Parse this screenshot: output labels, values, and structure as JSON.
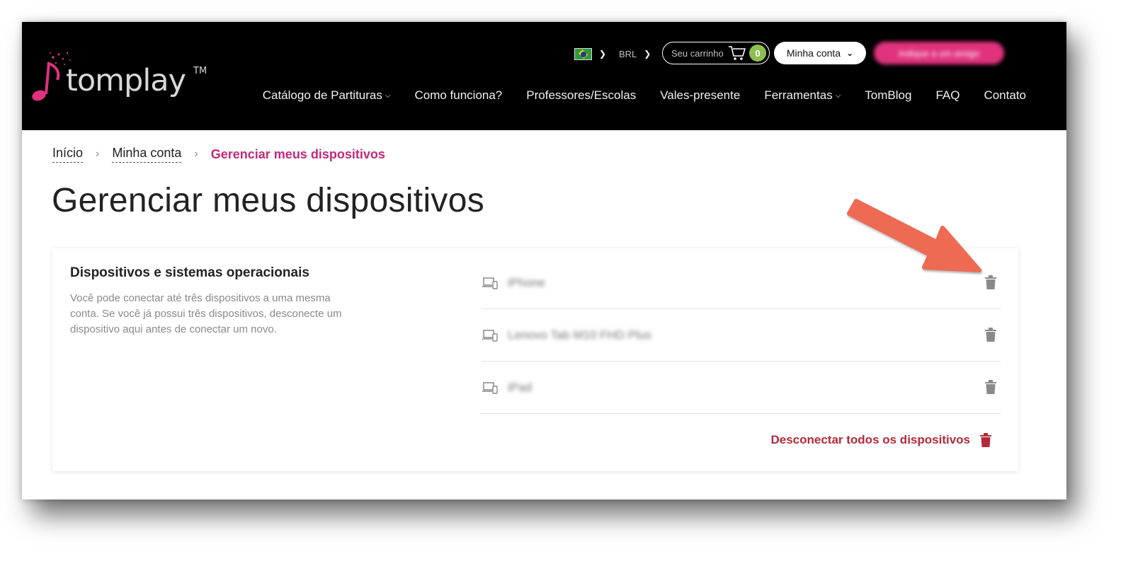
{
  "header": {
    "logo_text": "tomplay",
    "logo_tm": "TM",
    "currency": "BRL",
    "cart_label": "Seu carrinho",
    "cart_count": "0",
    "account_label": "Minha conta",
    "refer_label": "Indique a um amigo",
    "nav": [
      {
        "label": "Catálogo de Partituras"
      },
      {
        "label": "Como funciona?"
      },
      {
        "label": "Professores/Escolas"
      },
      {
        "label": "Vales-presente"
      },
      {
        "label": "Ferramentas"
      },
      {
        "label": "TomBlog"
      },
      {
        "label": "FAQ"
      },
      {
        "label": "Contato"
      }
    ]
  },
  "breadcrumb": {
    "home": "Início",
    "account": "Minha conta",
    "current": "Gerenciar meus dispositivos"
  },
  "page": {
    "title": "Gerenciar meus dispositivos"
  },
  "devices_card": {
    "title": "Dispositivos e sistemas operacionais",
    "description": "Você pode conectar até três dispositivos a uma mesma conta. Se você já possui três dispositivos, desconecte um dispositivo aqui antes de conectar um novo.",
    "devices": [
      {
        "name": "iPhone"
      },
      {
        "name": "Lenovo Tab M10 FHD Plus"
      },
      {
        "name": "iPad"
      }
    ],
    "disconnect_all": "Desconectar todos os dispositivos"
  },
  "colors": {
    "header_bg": "#000000",
    "accent_pink": "#e0327d",
    "breadcrumb_current": "#c3297a",
    "cart_badge": "#8dbf4f",
    "danger": "#b32a3a",
    "annotation_arrow": "#ee6b52"
  },
  "icons": {
    "flag": "brazil-flag-icon",
    "cart": "cart-icon",
    "device": "devices-icon",
    "trash": "trash-icon"
  }
}
